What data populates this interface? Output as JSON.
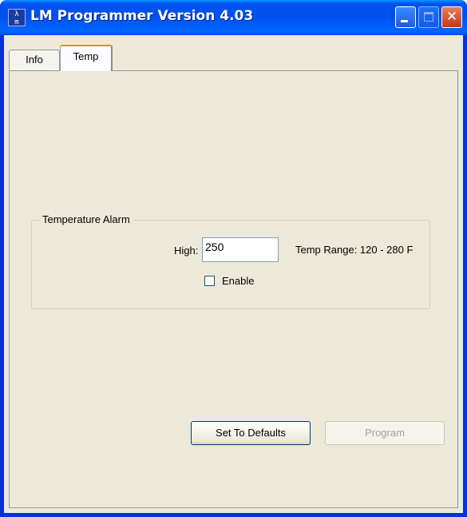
{
  "window": {
    "title": "LM Programmer Version 4.03",
    "icon_text": "λ\nm"
  },
  "titlebar_buttons": [
    "minimize-icon",
    "maximize-icon",
    "close-icon"
  ],
  "tabs": [
    {
      "label": "Info",
      "active": false
    },
    {
      "label": "Temp",
      "active": true
    }
  ],
  "temperature_alarm": {
    "group_label": "Temperature Alarm",
    "high_label": "High:",
    "high_value": "250",
    "range_text": "Temp Range: 120 - 280 F",
    "enable_label": "Enable",
    "enable_checked": false
  },
  "buttons": {
    "defaults_label": "Set To Defaults",
    "program_label": "Program",
    "program_enabled": false
  },
  "colors": {
    "titlebar": "#0054e3",
    "client_bg": "#ece9d8",
    "active_tab_accent": "#e68b2c"
  }
}
